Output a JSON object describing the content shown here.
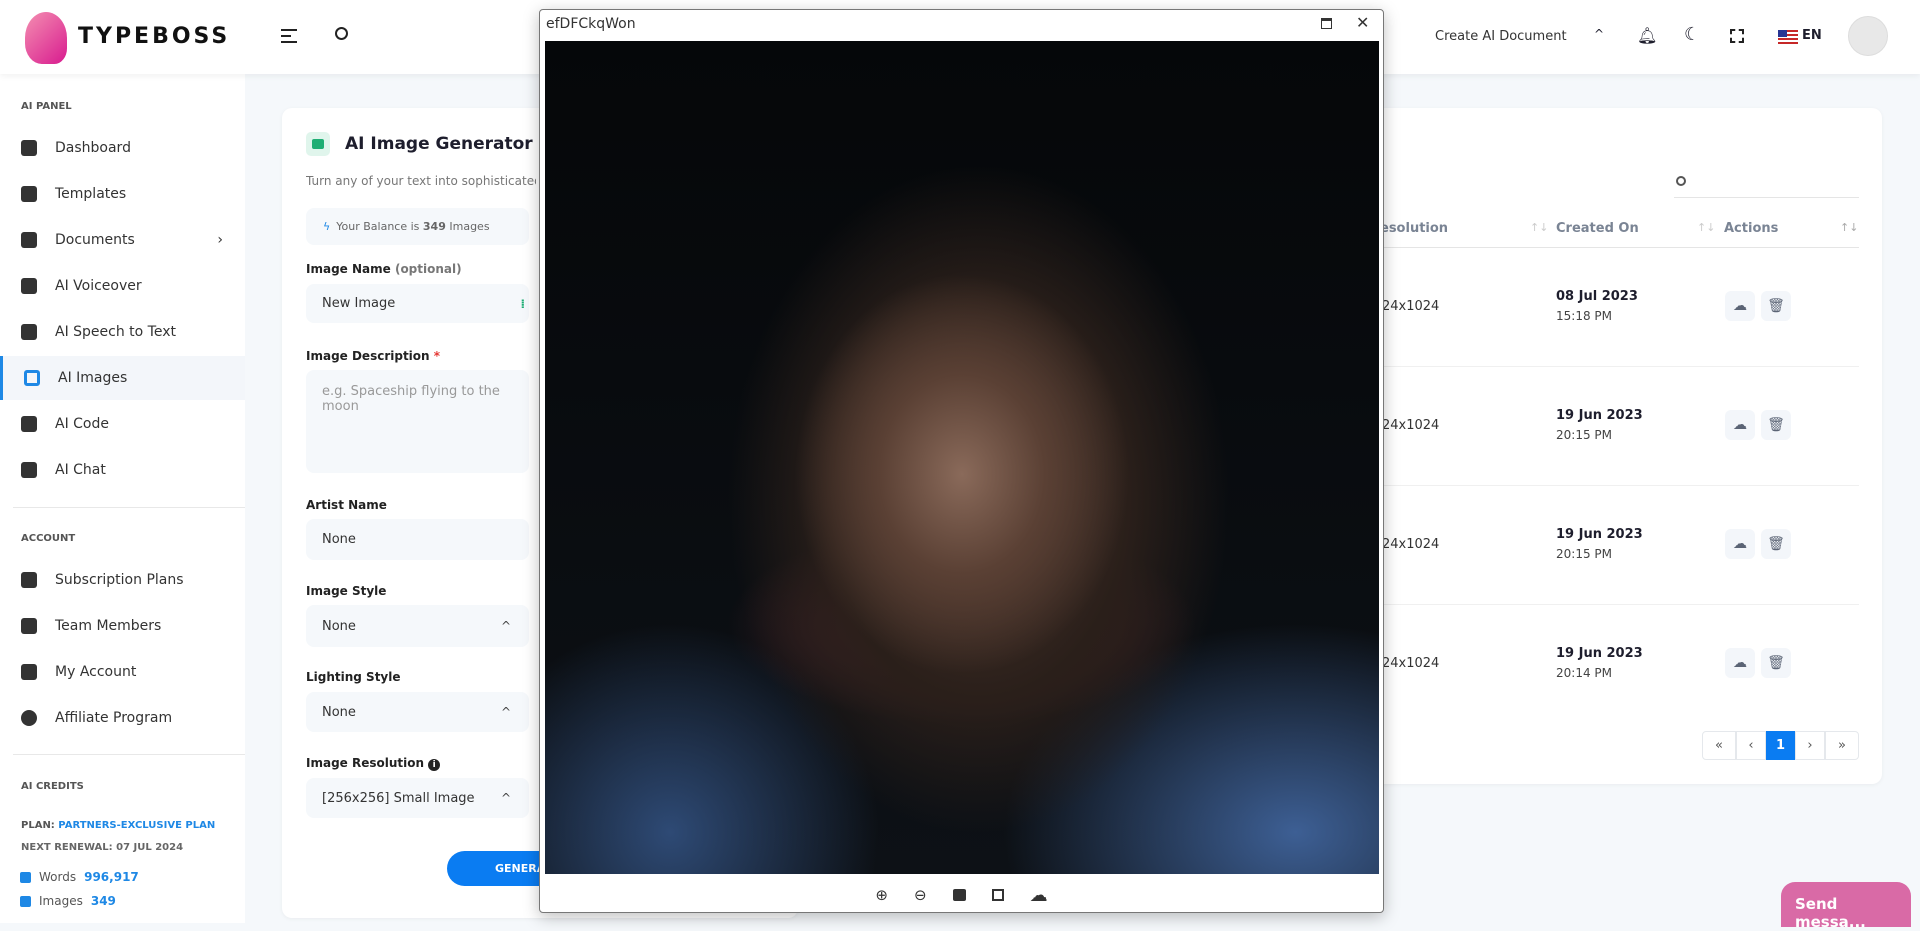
{
  "brand": {
    "name": "TYPEBOSS"
  },
  "header": {
    "create_doc": "Create AI Document",
    "lang": "EN",
    "icons": [
      "menu-icon",
      "search-icon",
      "bell-icon",
      "moon-icon",
      "fullscreen-icon",
      "us-flag-icon",
      "avatar"
    ]
  },
  "sidebar": {
    "sections": [
      "AI PANEL",
      "ACCOUNT",
      "AI CREDITS"
    ],
    "ai_panel": [
      {
        "label": "Dashboard"
      },
      {
        "label": "Templates"
      },
      {
        "label": "Documents"
      },
      {
        "label": "AI Voiceover"
      },
      {
        "label": "AI Speech to Text"
      },
      {
        "label": "AI Images",
        "active": true
      },
      {
        "label": "AI Code"
      },
      {
        "label": "AI Chat"
      }
    ],
    "account": [
      {
        "label": "Subscription Plans"
      },
      {
        "label": "Team Members"
      },
      {
        "label": "My Account"
      },
      {
        "label": "Affiliate Program"
      }
    ],
    "credits": {
      "plan_label": "PLAN:",
      "plan": "PARTNERS-EXCLUSIVE PLAN",
      "renewal": "NEXT RENEWAL: 07 JUL 2024",
      "words_label": "Words",
      "words": "996,917",
      "images_label": "Images",
      "images": "349",
      "accent": "#1e88e5"
    }
  },
  "form": {
    "title": "AI Image Generator",
    "subtitle": "Turn any of your text into sophisticated",
    "balance_pre": "Your Balance is ",
    "balance_num": "349",
    "balance_post": " Images",
    "name_label": "Image Name",
    "name_optional": "(optional)",
    "name_value": "New Image",
    "desc_label": "Image Description",
    "desc_req": "*",
    "desc_placeholder": "e.g. Spaceship flying to the moon",
    "artist_label": "Artist Name",
    "artist_value": "None",
    "style_label": "Image Style",
    "style_value": "None",
    "lighting_label": "Lighting Style",
    "lighting_value": "None",
    "res_label": "Image Resolution",
    "res_value": "[256x256] Small Image",
    "generate": "GENERA"
  },
  "table": {
    "headers": [
      "esolution",
      "Created On",
      "Actions"
    ],
    "rows": [
      {
        "res": "24x1024",
        "date": "08 Jul 2023",
        "time": "15:18 PM"
      },
      {
        "res": "24x1024",
        "date": "19 Jun 2023",
        "time": "20:15 PM"
      },
      {
        "res": "24x1024",
        "date": "19 Jun 2023",
        "time": "20:15 PM"
      },
      {
        "res": "24x1024",
        "date": "19 Jun 2023",
        "time": "20:14 PM"
      }
    ],
    "pagination": [
      "«",
      "‹",
      "1",
      "›",
      "»"
    ]
  },
  "modal": {
    "title": "efDFCkqWon",
    "tools": [
      "zoom-in-icon",
      "zoom-out-icon",
      "image-icon",
      "fit-screen-icon",
      "download-icon"
    ]
  },
  "chat": {
    "label": "Send messa..."
  }
}
